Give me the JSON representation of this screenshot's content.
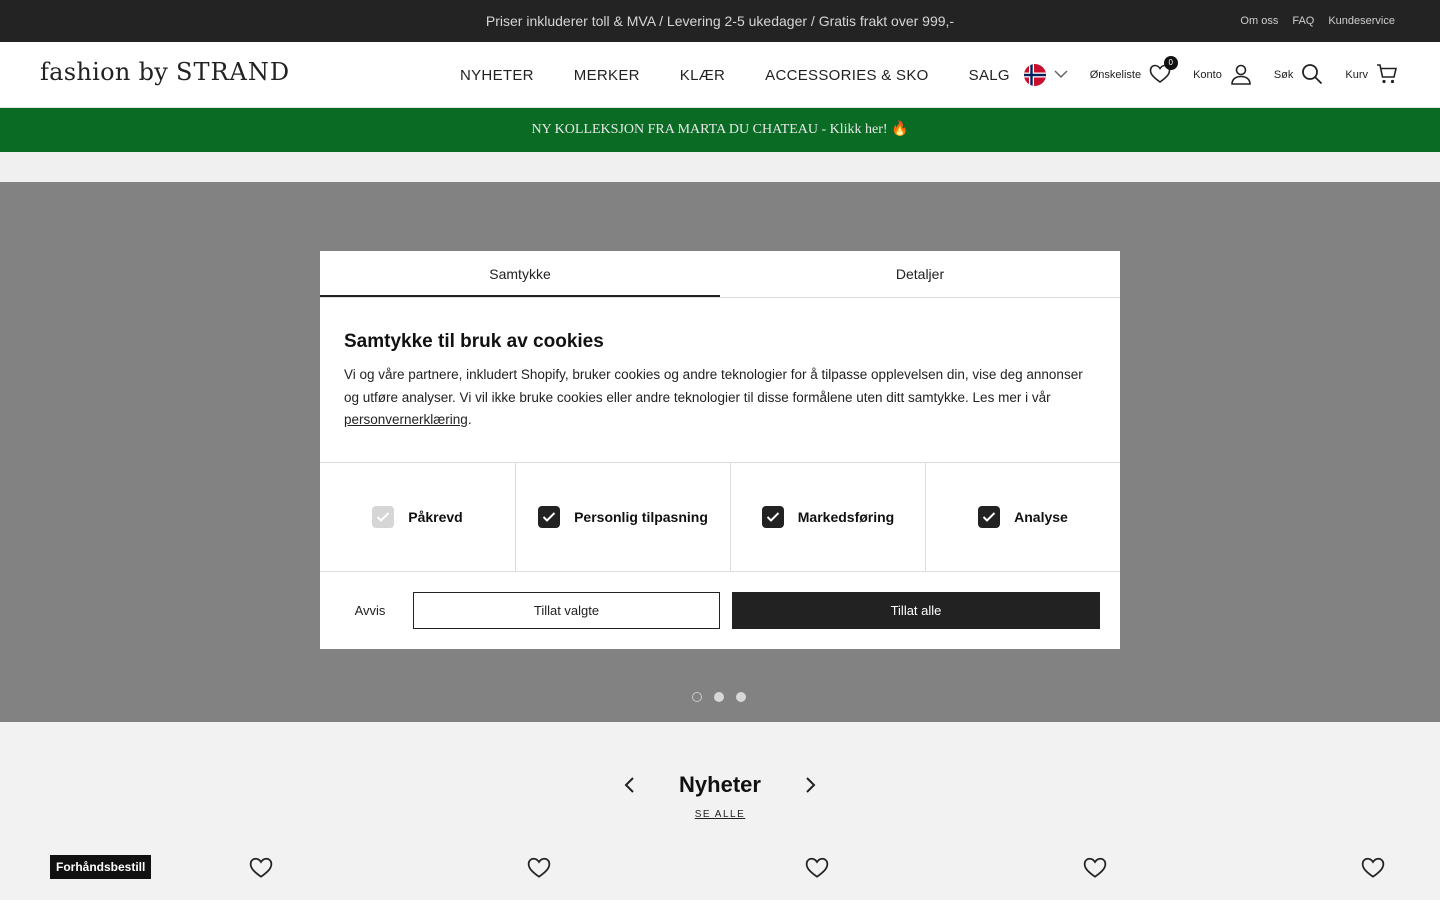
{
  "topbar": {
    "message": "Priser inkluderer toll & MVA  / Levering 2-5 ukedager / Gratis frakt over 999,-",
    "links": [
      "Om oss",
      "FAQ",
      "Kundeservice"
    ]
  },
  "header": {
    "logo_prefix": "fashion by ",
    "logo_brand": "STRAND",
    "nav": [
      "NYHETER",
      "MERKER",
      "KLÆR",
      "ACCESSORIES & SKO",
      "SALG"
    ],
    "wishlist_label": "Ønskeliste",
    "wishlist_count": "0",
    "account_label": "Konto",
    "search_label": "Søk",
    "cart_label": "Kurv"
  },
  "promo": {
    "text": "NY KOLLEKSJON FRA MARTA DU CHATEAU - Klikk her! 🔥"
  },
  "section": {
    "title": "Nyheter",
    "link": "SE ALLE",
    "badge": "Forhåndsbestill"
  },
  "consent": {
    "tab_consent": "Samtykke",
    "tab_details": "Detaljer",
    "title": "Samtykke til bruk av cookies",
    "desc_main": "Vi og våre partnere, inkludert Shopify, bruker cookies og andre teknologier for å tilpasse opplevelsen din, vise deg annonser og utføre analyser. Vi vil ikke bruke cookies eller andre teknologier til disse formålene uten ditt samtykke. Les mer i vår ",
    "desc_link": "personvernerklæring",
    "desc_end": ".",
    "categories": [
      {
        "label": "Påkrevd",
        "checked": true,
        "disabled": true
      },
      {
        "label": "Personlig tilpasning",
        "checked": true,
        "disabled": false
      },
      {
        "label": "Markedsføring",
        "checked": true,
        "disabled": false
      },
      {
        "label": "Analyse",
        "checked": true,
        "disabled": false
      }
    ],
    "reject": "Avvis",
    "allow_selected": "Tillat valgte",
    "allow_all": "Tillat alle"
  },
  "colors": {
    "promo_bg": "#0a6b24",
    "topbar_bg": "#232323",
    "button_dark": "#222222"
  }
}
